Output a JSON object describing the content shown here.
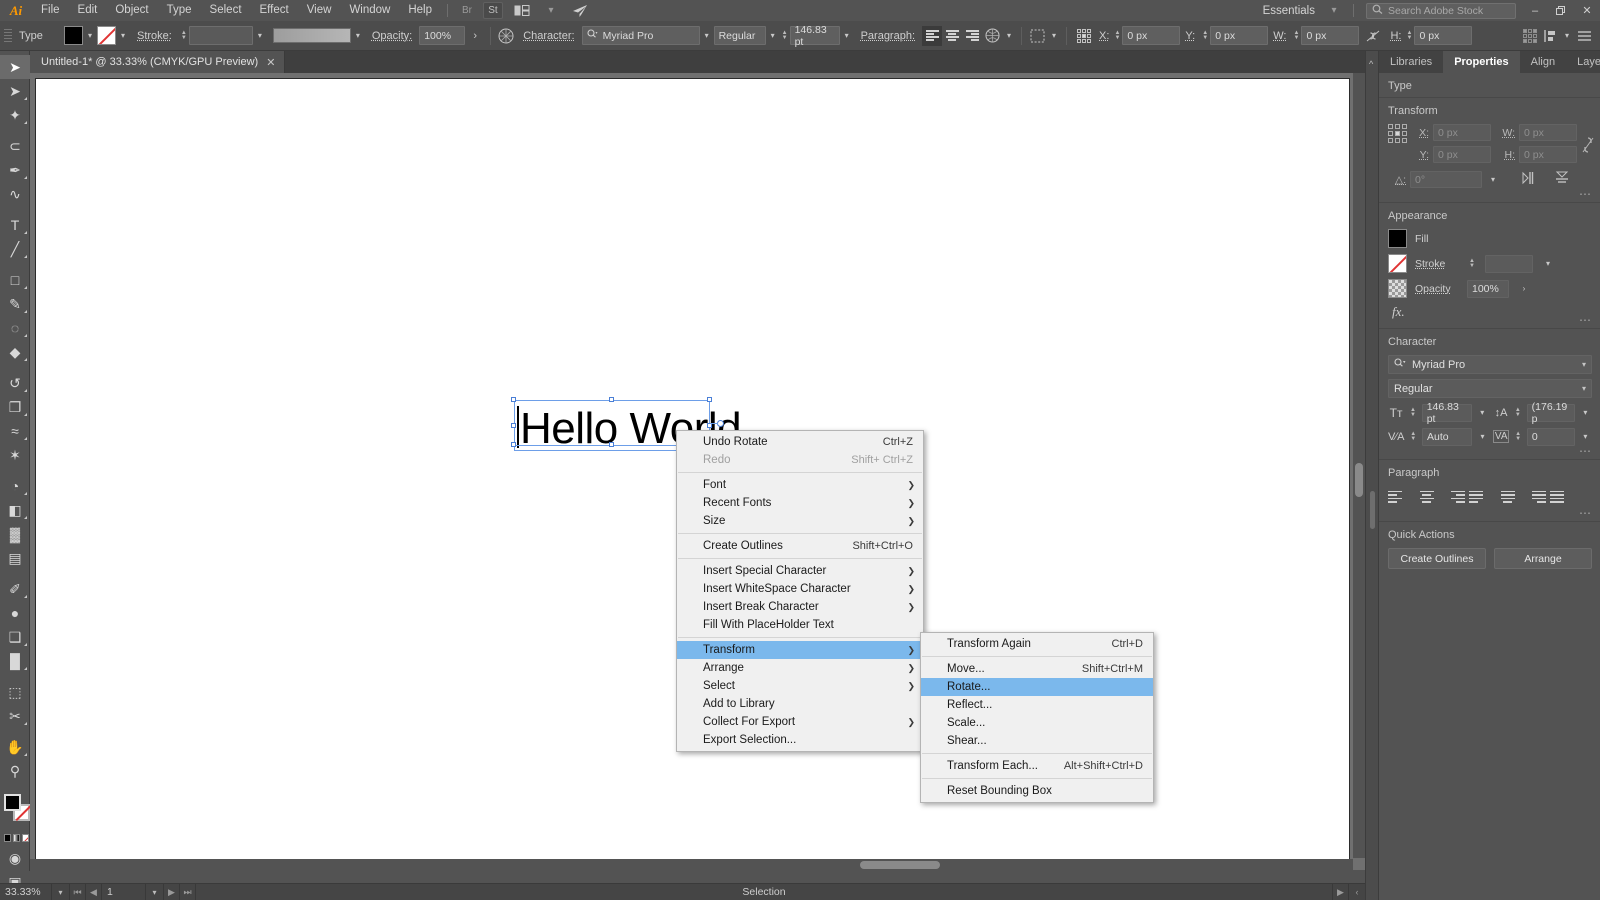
{
  "app": {
    "logo": "Ai",
    "workspace": "Essentials",
    "stock_search_placeholder": "Search Adobe Stock"
  },
  "menubar": {
    "items": [
      "File",
      "Edit",
      "Object",
      "Type",
      "Select",
      "Effect",
      "View",
      "Window",
      "Help"
    ],
    "bridge_label": "Br",
    "stock_label": "St",
    "arrange_icon": "arrange-documents-icon",
    "share_icon": "share-icon",
    "minimize": "–",
    "maximize": "❐",
    "close": "✕"
  },
  "controlbar": {
    "context_label": "Type",
    "fill_swatch": "black",
    "stroke_swatch": "none",
    "stroke_label": "Stroke:",
    "stroke_weight": "",
    "opacity_label": "Opacity:",
    "opacity_value": "100%",
    "character_label": "Character:",
    "font_family": "Myriad Pro",
    "font_style": "Regular",
    "font_size": "146.83 pt",
    "paragraph_label": "Paragraph:",
    "x_label": "X:",
    "x_value": "0 px",
    "y_label": "Y:",
    "y_value": "0 px",
    "w_label": "W:",
    "w_value": "0 px",
    "h_label": "H:",
    "h_value": "0 px"
  },
  "toolbox": {
    "tools": [
      {
        "name": "selection-tool",
        "glyph": "➤",
        "selected": true,
        "sub": false
      },
      {
        "name": "direct-selection-tool",
        "glyph": "➤",
        "selected": false,
        "sub": true
      },
      {
        "name": "magic-wand-tool",
        "glyph": "✦",
        "selected": false,
        "sub": true
      },
      {
        "name": "lasso-tool",
        "glyph": "⊂",
        "selected": false,
        "sub": false
      },
      {
        "name": "pen-tool",
        "glyph": "✒",
        "selected": false,
        "sub": true
      },
      {
        "name": "curvature-tool",
        "glyph": "∿",
        "selected": false,
        "sub": false
      },
      {
        "name": "type-tool",
        "glyph": "T",
        "selected": false,
        "sub": true
      },
      {
        "name": "line-segment-tool",
        "glyph": "╱",
        "selected": false,
        "sub": true
      },
      {
        "name": "rectangle-tool",
        "glyph": "□",
        "selected": false,
        "sub": true
      },
      {
        "name": "paintbrush-tool",
        "glyph": "✎",
        "selected": false,
        "sub": true
      },
      {
        "name": "shaper-tool",
        "glyph": "◌",
        "selected": false,
        "sub": true
      },
      {
        "name": "eraser-tool",
        "glyph": "◆",
        "selected": false,
        "sub": true
      },
      {
        "name": "rotate-tool",
        "glyph": "↺",
        "selected": false,
        "sub": true
      },
      {
        "name": "scale-tool",
        "glyph": "❐",
        "selected": false,
        "sub": true
      },
      {
        "name": "width-tool",
        "glyph": "≈",
        "selected": false,
        "sub": true
      },
      {
        "name": "free-transform-tool",
        "glyph": "✶",
        "selected": false,
        "sub": false
      },
      {
        "name": "shape-builder-tool",
        "glyph": "◔",
        "selected": false,
        "sub": true
      },
      {
        "name": "perspective-grid-tool",
        "glyph": "◧",
        "selected": false,
        "sub": true
      },
      {
        "name": "mesh-tool",
        "glyph": "▓",
        "selected": false,
        "sub": false
      },
      {
        "name": "gradient-tool",
        "glyph": "▤",
        "selected": false,
        "sub": false
      },
      {
        "name": "eyedropper-tool",
        "glyph": "✐",
        "selected": false,
        "sub": true
      },
      {
        "name": "blend-tool",
        "glyph": "●",
        "selected": false,
        "sub": false
      },
      {
        "name": "symbol-sprayer-tool",
        "glyph": "❑",
        "selected": false,
        "sub": true
      },
      {
        "name": "column-graph-tool",
        "glyph": "█",
        "selected": false,
        "sub": true
      },
      {
        "name": "artboard-tool",
        "glyph": "⬚",
        "selected": false,
        "sub": false
      },
      {
        "name": "slice-tool",
        "glyph": "✂",
        "selected": false,
        "sub": true
      },
      {
        "name": "hand-tool",
        "glyph": "✋",
        "selected": false,
        "sub": true
      },
      {
        "name": "zoom-tool",
        "glyph": "⚲",
        "selected": false,
        "sub": false
      }
    ]
  },
  "document": {
    "tab_title": "Untitled-1* @ 33.33% (CMYK/GPU Preview)",
    "close_glyph": "✕",
    "canvas_text": "Hello World"
  },
  "statusbar": {
    "zoom": "33.33%",
    "page": "1",
    "status": "Selection",
    "first_glyph": "⏮",
    "prev_glyph": "◀",
    "next_glyph": "▶",
    "last_glyph": "⏭",
    "play_glyph": "▶",
    "chev_glyph": "‹"
  },
  "context_menu": {
    "items": [
      {
        "label": "Undo Rotate",
        "shortcut": "Ctrl+Z",
        "arrow": false,
        "disabled": false,
        "highlight": false
      },
      {
        "label": "Redo",
        "shortcut": "Shift+ Ctrl+Z",
        "arrow": false,
        "disabled": true,
        "highlight": false
      },
      {
        "sep": true
      },
      {
        "label": "Font",
        "shortcut": "",
        "arrow": true,
        "disabled": false,
        "highlight": false
      },
      {
        "label": "Recent Fonts",
        "shortcut": "",
        "arrow": true,
        "disabled": false,
        "highlight": false
      },
      {
        "label": "Size",
        "shortcut": "",
        "arrow": true,
        "disabled": false,
        "highlight": false
      },
      {
        "sep": true
      },
      {
        "label": "Create Outlines",
        "shortcut": "Shift+Ctrl+O",
        "arrow": false,
        "disabled": false,
        "highlight": false
      },
      {
        "sep": true
      },
      {
        "label": "Insert Special Character",
        "shortcut": "",
        "arrow": true,
        "disabled": false,
        "highlight": false
      },
      {
        "label": "Insert WhiteSpace Character",
        "shortcut": "",
        "arrow": true,
        "disabled": false,
        "highlight": false
      },
      {
        "label": "Insert Break Character",
        "shortcut": "",
        "arrow": true,
        "disabled": false,
        "highlight": false
      },
      {
        "label": "Fill With PlaceHolder Text",
        "shortcut": "",
        "arrow": false,
        "disabled": false,
        "highlight": false
      },
      {
        "sep": true
      },
      {
        "label": "Transform",
        "shortcut": "",
        "arrow": true,
        "disabled": false,
        "highlight": true
      },
      {
        "label": "Arrange",
        "shortcut": "",
        "arrow": true,
        "disabled": false,
        "highlight": false
      },
      {
        "label": "Select",
        "shortcut": "",
        "arrow": true,
        "disabled": false,
        "highlight": false
      },
      {
        "label": "Add to Library",
        "shortcut": "",
        "arrow": false,
        "disabled": false,
        "highlight": false
      },
      {
        "label": "Collect For Export",
        "shortcut": "",
        "arrow": true,
        "disabled": false,
        "highlight": false
      },
      {
        "label": "Export Selection...",
        "shortcut": "",
        "arrow": false,
        "disabled": false,
        "highlight": false
      }
    ]
  },
  "context_submenu": {
    "items": [
      {
        "label": "Transform Again",
        "shortcut": "Ctrl+D",
        "disabled": false,
        "highlight": false
      },
      {
        "sep": true
      },
      {
        "label": "Move...",
        "shortcut": "Shift+Ctrl+M",
        "disabled": false,
        "highlight": false
      },
      {
        "label": "Rotate...",
        "shortcut": "",
        "disabled": false,
        "highlight": true
      },
      {
        "label": "Reflect...",
        "shortcut": "",
        "disabled": false,
        "highlight": false
      },
      {
        "label": "Scale...",
        "shortcut": "",
        "disabled": false,
        "highlight": false
      },
      {
        "label": "Shear...",
        "shortcut": "",
        "disabled": false,
        "highlight": false
      },
      {
        "sep": true
      },
      {
        "label": "Transform Each...",
        "shortcut": "Alt+Shift+Ctrl+D",
        "disabled": false,
        "highlight": false
      },
      {
        "sep": true
      },
      {
        "label": "Reset Bounding Box",
        "shortcut": "",
        "disabled": false,
        "highlight": false
      }
    ]
  },
  "panels": {
    "tabs": [
      {
        "label": "Libraries",
        "active": false
      },
      {
        "label": "Properties",
        "active": true
      },
      {
        "label": "Align",
        "active": false
      },
      {
        "label": "Layers",
        "active": false
      }
    ],
    "type_header": "Type",
    "transform": {
      "title": "Transform",
      "x_label": "X:",
      "x_value": "0 px",
      "y_label": "Y:",
      "y_value": "0 px",
      "w_label": "W:",
      "w_value": "0 px",
      "h_label": "H:",
      "h_value": "0 px",
      "angle_label": "△:",
      "angle_value": "0°",
      "link_icon": "chain-link-broken-icon",
      "flip_h_icon": "flip-horizontal-icon",
      "flip_v_icon": "flip-vertical-icon"
    },
    "appearance": {
      "title": "Appearance",
      "fill_label": "Fill",
      "stroke_label": "Stroke",
      "stroke_weight": "",
      "opacity_label": "Opacity",
      "opacity_value": "100%",
      "fx_label": "fx."
    },
    "character": {
      "title": "Character",
      "font_family": "Myriad Pro",
      "font_style": "Regular",
      "font_size": "146.83 pt",
      "leading": "(176.19 p",
      "kerning": "Auto",
      "tracking": "0"
    },
    "paragraph": {
      "title": "Paragraph"
    },
    "quick_actions": {
      "title": "Quick Actions",
      "create_outlines": "Create Outlines",
      "arrange": "Arrange"
    }
  },
  "colors": {
    "chrome": "#535353",
    "panel": "#4c4c4c",
    "accent_highlight": "#7bb8ec",
    "menu_bg": "#f0f0f0",
    "selection_blue": "#6d9ee8",
    "logo_orange": "#ff9a00"
  }
}
